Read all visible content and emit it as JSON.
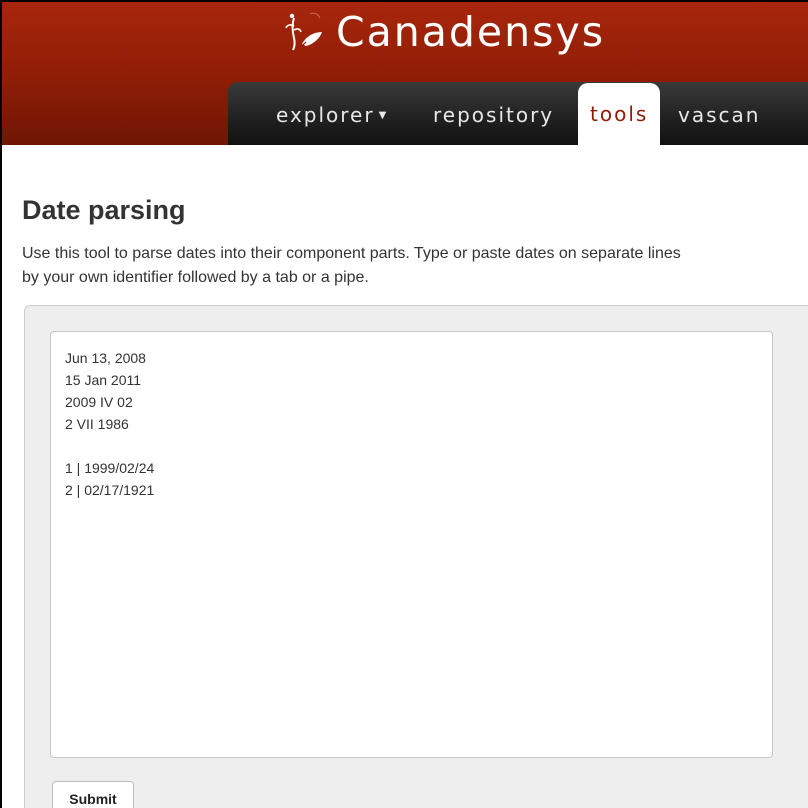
{
  "brand": {
    "name": "Canadensys"
  },
  "nav": {
    "items": [
      {
        "label": "explorer",
        "has_dropdown": true
      },
      {
        "label": "repository"
      },
      {
        "label": "tools",
        "active": true
      },
      {
        "label": "vascan"
      }
    ]
  },
  "page": {
    "title": "Date parsing",
    "intro_line1": "Use this tool to parse dates into their component parts. Type or paste dates on separate lines",
    "intro_line2": "by your own identifier followed by a tab or a pipe."
  },
  "form": {
    "lines": [
      "Jun 13, 2008",
      "15 Jan 2011",
      "2009 IV 02",
      "2 VII 1986",
      "",
      "1 | 1999/02/24",
      "2 | 02/17/1921"
    ],
    "submit_label": "Submit"
  },
  "colors": {
    "header": "#8e1d06",
    "nav": "#202020",
    "active_tab_text": "#8e1d06"
  }
}
